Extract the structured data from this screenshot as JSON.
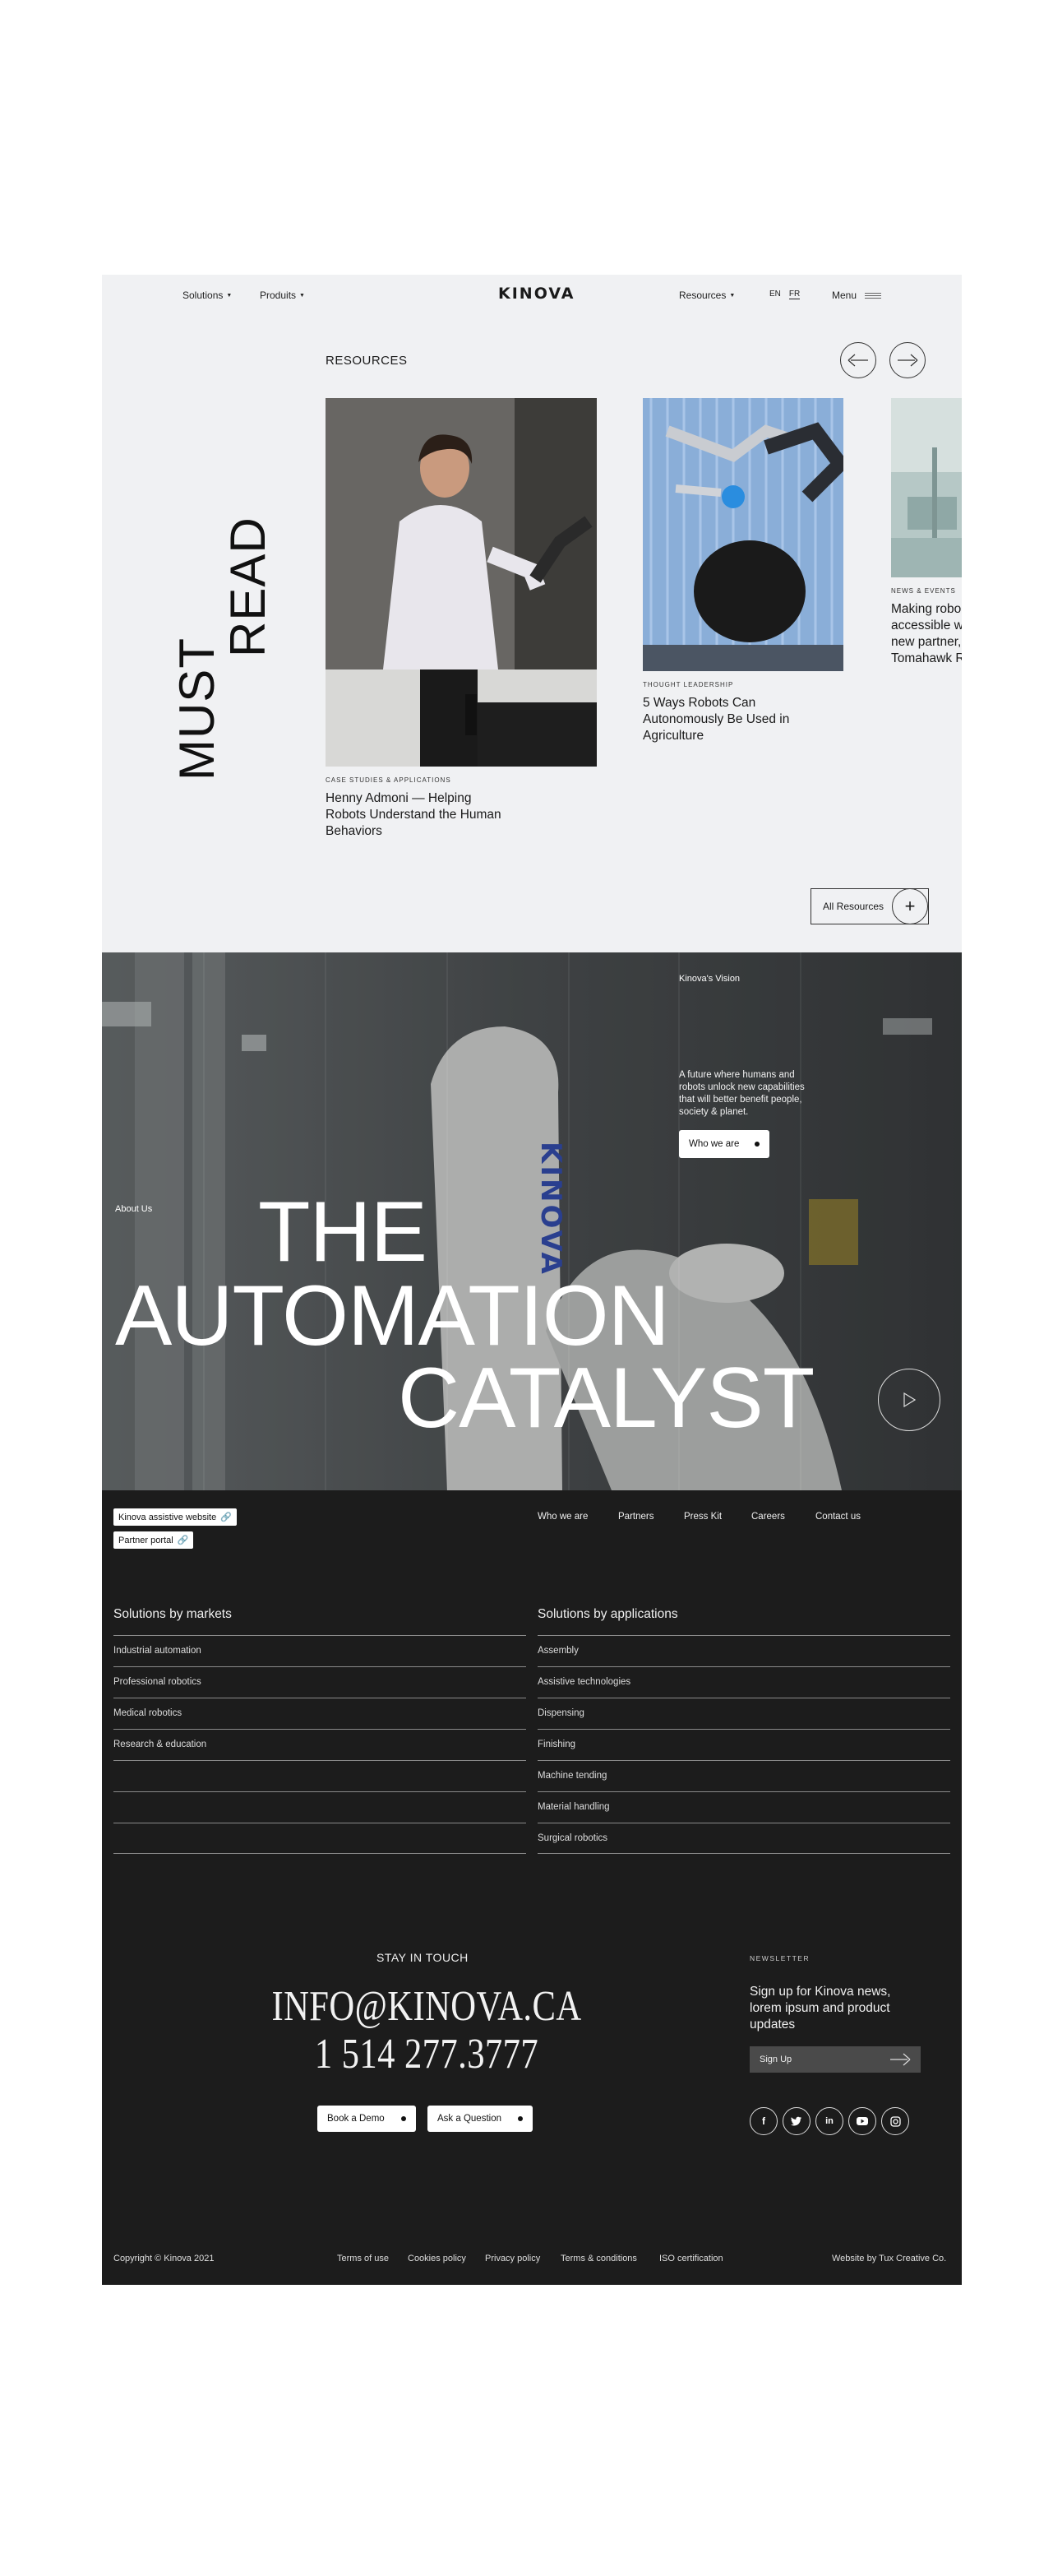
{
  "nav": {
    "solutions": "Solutions",
    "produits": "Produits",
    "logo": "KINOVA",
    "resources": "Resources",
    "lang_en": "EN",
    "lang_fr": "FR",
    "menu": "Menu"
  },
  "resources": {
    "heading_line1": "MUST",
    "heading_line2": "READ",
    "title": "RESOURCES",
    "cards": [
      {
        "category": "CASE STUDIES & APPLICATIONS",
        "title": "Henny Admoni — Helping Robots Understand the Human Behaviors"
      },
      {
        "category": "THOUGHT LEADERSHIP",
        "title": "5 Ways Robots Can Autonomously Be Used in Agriculture"
      },
      {
        "category": "NEWS & EVENTS",
        "title": "Making robo accessible w new partner, Tomahawk R"
      }
    ],
    "all_resources": "All Resources"
  },
  "hero": {
    "vision_label": "Kinova's Vision",
    "vision_text": "A future where humans and robots unlock new capabilities that will better benefit people, society & planet.",
    "who_we_are": "Who we are",
    "about_us": "About Us",
    "line1": "THE",
    "line2": "AUTOMATION",
    "line3": "CATALYST",
    "arm_brand": "KINOVA"
  },
  "footer": {
    "assistive_website": "Kinova assistive website",
    "partner_portal": "Partner portal",
    "nav": [
      "Who we are",
      "Partners",
      "Press Kit",
      "Careers",
      "Contact us"
    ],
    "markets_title": "Solutions by markets",
    "markets": [
      "Industrial automation",
      "Professional robotics",
      "Medical robotics",
      "Research & education"
    ],
    "applications_title": "Solutions by applications",
    "applications": [
      "Assembly",
      "Assistive technologies",
      "Dispensing",
      "Finishing",
      "Machine tending",
      "Material handling",
      "Surgical robotics"
    ],
    "stay_in_touch": "STAY IN TOUCH",
    "email": "INFO@KINOVA.CA",
    "phone": "1 514 277.3777",
    "book_demo": "Book a Demo",
    "ask_question": "Ask a Question",
    "newsletter_label": "NEWSLETTER",
    "newsletter_text": "Sign up for Kinova news, lorem ipsum and product updates",
    "sign_up": "Sign Up",
    "social": [
      "facebook-icon",
      "twitter-icon",
      "linkedin-icon",
      "youtube-icon",
      "instagram-icon"
    ],
    "copyright": "Copyright © Kinova 2021",
    "legal": [
      "Terms of use",
      "Cookies policy",
      "Privacy policy",
      "Terms & conditions",
      "ISO certification"
    ],
    "credit": "Website by Tux Creative Co."
  },
  "colors": {
    "top_bg": "#f0f1f3",
    "footer_bg": "#1c1c1c",
    "hero_bg": "#4f5253"
  }
}
